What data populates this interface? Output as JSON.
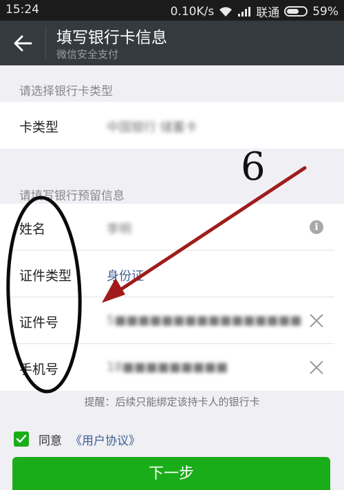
{
  "status_bar": {
    "time": "15:24",
    "speed": "0.10K/s",
    "carrier": "联通",
    "battery": "59%",
    "battery_level": 0.59
  },
  "nav": {
    "back_icon": "arrow-left-icon",
    "title": "填写银行卡信息",
    "subtitle": "微信安全支付"
  },
  "card_section": {
    "header": "请选择银行卡类型",
    "rows": [
      {
        "label": "卡类型",
        "value": "中国银行 储蓄卡"
      }
    ]
  },
  "info_section": {
    "header": "请填写银行预留信息",
    "rows": [
      {
        "label": "姓名",
        "value": "李明",
        "icon": "info-icon"
      },
      {
        "label": "证件类型",
        "value": "身份证"
      },
      {
        "label": "证件号",
        "value": "5■■■■■■■■■■■■■■■■",
        "icon": "clear-icon"
      },
      {
        "label": "手机号",
        "value": "18■■■■■■■■■",
        "icon": "clear-icon"
      }
    ]
  },
  "hint": "提醒：后续只能绑定该持卡人的银行卡",
  "agreement": {
    "checked": true,
    "text": "同意",
    "link": "《用户协议》"
  },
  "next_button": "下一步",
  "annotation": {
    "number": "6",
    "color": "#a01c1c"
  },
  "colors": {
    "primary_green": "#1aad19",
    "nav_bg": "#353a3e",
    "link_blue": "#3e5f94"
  }
}
